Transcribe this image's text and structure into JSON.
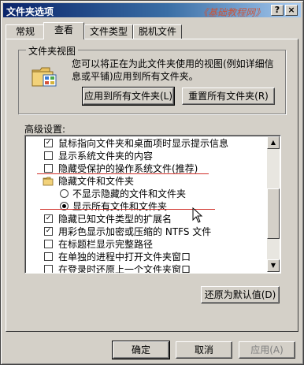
{
  "window": {
    "title": "文件夹选项",
    "watermark": "《基础教程网》",
    "help_button": "?",
    "close_button": "×"
  },
  "tabs": [
    {
      "label": "常规",
      "active": false
    },
    {
      "label": "查看",
      "active": true
    },
    {
      "label": "文件类型",
      "active": false
    },
    {
      "label": "脱机文件",
      "active": false
    }
  ],
  "folder_views": {
    "group_label": "文件夹视图",
    "description": "您可以将正在为此文件夹使用的视图(例如详细信息或平铺)应用到所有文件夹。",
    "apply_all_button": "应用到所有文件夹(L)",
    "reset_all_button": "重置所有文件夹(R)"
  },
  "advanced": {
    "label": "高级设置:",
    "items": [
      {
        "type": "checkbox",
        "checked": true,
        "indent": 0,
        "label": "鼠标指向文件夹和桌面项时显示提示信息"
      },
      {
        "type": "checkbox",
        "checked": false,
        "indent": 0,
        "label": "显示系统文件夹的内容"
      },
      {
        "type": "checkbox",
        "checked": false,
        "indent": 0,
        "label": "隐藏受保护的操作系统文件(推荐)"
      },
      {
        "type": "folder",
        "checked": false,
        "indent": 0,
        "label": "隐藏文件和文件夹"
      },
      {
        "type": "radio",
        "checked": false,
        "indent": 1,
        "label": "不显示隐藏的文件和文件夹"
      },
      {
        "type": "radio",
        "checked": true,
        "indent": 1,
        "label": "显示所有文件和文件夹"
      },
      {
        "type": "checkbox",
        "checked": true,
        "indent": 0,
        "label": "隐藏已知文件类型的扩展名"
      },
      {
        "type": "checkbox",
        "checked": true,
        "indent": 0,
        "label": "用彩色显示加密或压缩的 NTFS 文件"
      },
      {
        "type": "checkbox",
        "checked": false,
        "indent": 0,
        "label": "在标题栏显示完整路径"
      },
      {
        "type": "checkbox",
        "checked": false,
        "indent": 0,
        "label": "在单独的进程中打开文件夹窗口"
      },
      {
        "type": "checkbox",
        "checked": false,
        "indent": 0,
        "label": "在登录时还原上一个文件夹窗口"
      }
    ],
    "restore_defaults_button": "还原为默认值(D)"
  },
  "footer": {
    "ok": "确定",
    "cancel": "取消",
    "apply": "应用(A)"
  },
  "colors": {
    "annotation_line": "#d0302a",
    "titlebar_start": "#0a246a",
    "titlebar_end": "#a6caf0"
  }
}
